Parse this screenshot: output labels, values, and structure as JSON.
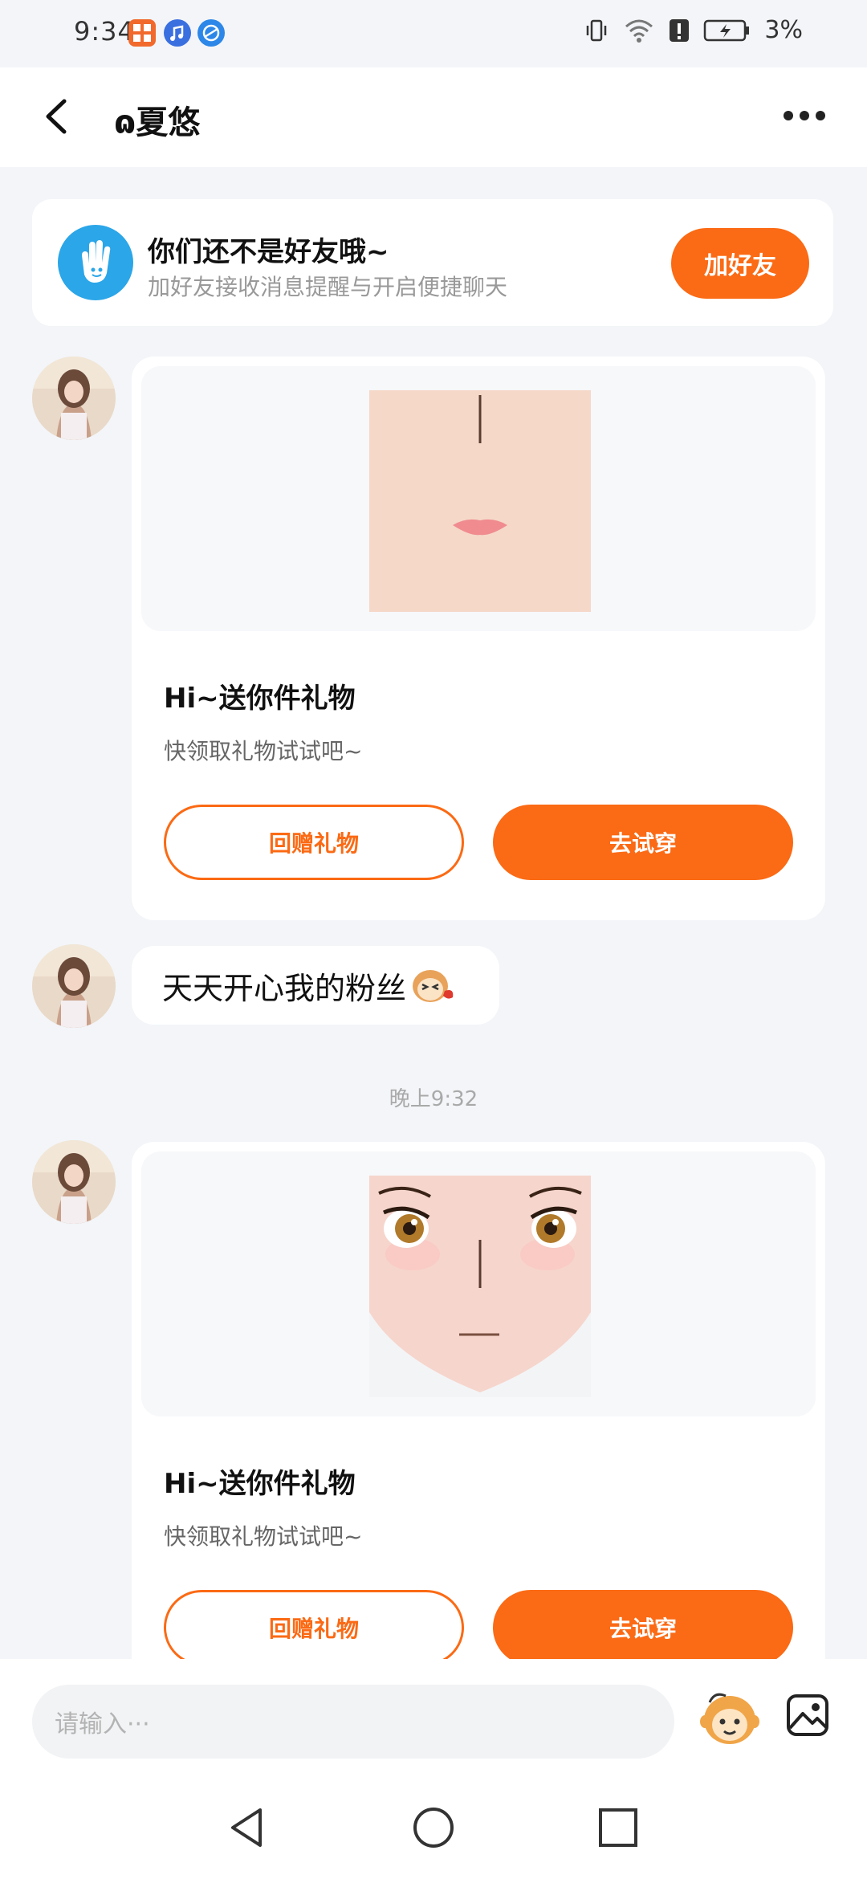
{
  "status_bar": {
    "time": "9:34",
    "battery": "3%",
    "app_icons": [
      "app-icon-orange",
      "music-icon",
      "browser-icon"
    ]
  },
  "header": {
    "title": "ɷ夏悠",
    "back_icon": "back-arrow-icon",
    "more_icon": "more-dots-icon"
  },
  "friend_banner": {
    "title": "你们还不是好友哦~",
    "subtitle": "加好友接收消息提醒与开启便捷聊天",
    "button": "加好友",
    "icon": "wave-hand-icon"
  },
  "messages": [
    {
      "type": "gift",
      "title": "Hi~送你件礼物",
      "description": "快领取礼物试试吧~",
      "return_button": "回赠礼物",
      "try_button": "去试穿",
      "preview": "face-mouth"
    },
    {
      "type": "text",
      "text": "天天开心我的粉丝",
      "emoji": "monkey-emoji"
    },
    {
      "type": "timestamp",
      "text": "晚上9:32"
    },
    {
      "type": "gift",
      "title": "Hi~送你件礼物",
      "description": "快领取礼物试试吧~",
      "return_button": "回赠礼物",
      "try_button": "去试穿",
      "preview": "face-eyes"
    }
  ],
  "input": {
    "placeholder": "请输入···"
  },
  "colors": {
    "accent": "#fb6a14",
    "background": "#f3f5f8",
    "banner_icon": "#2ba6e8"
  }
}
